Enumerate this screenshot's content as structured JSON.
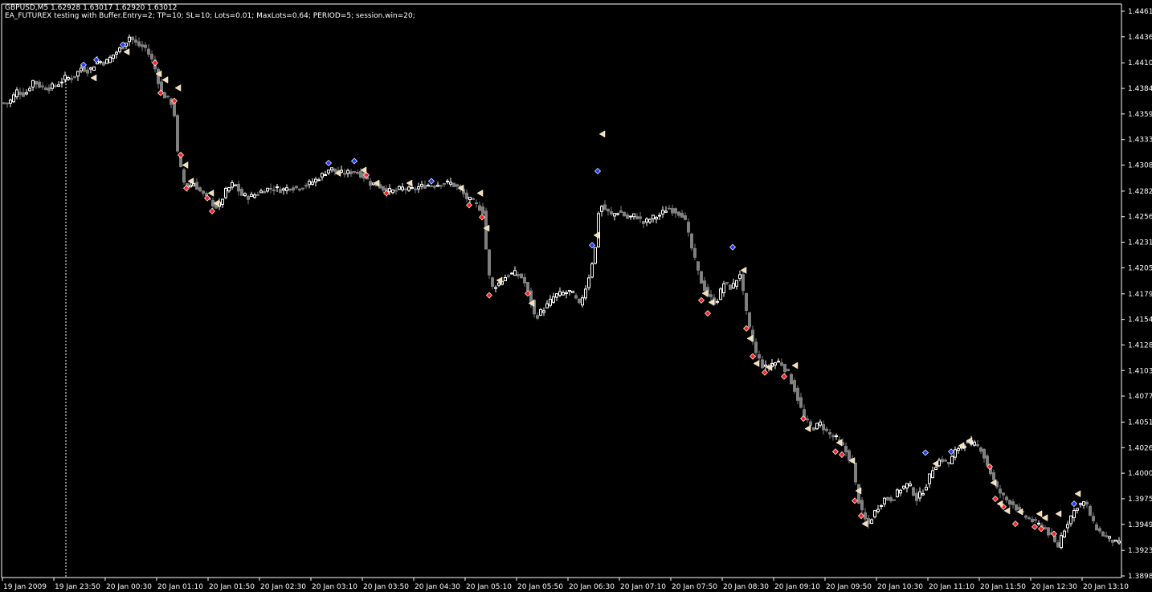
{
  "window": {
    "header": "GBPUSD,M5  1.62928 1.63017 1.62920 1.63012",
    "ea_info": "EA_FUTUREX testing with Buffer.Entry=2; TP=10; SL=10; Lots=0.01; MaxLots=0.64; PERIOD=5; session.win=20;"
  },
  "colors": {
    "background": "#000000",
    "bull_candle": "#ffffff",
    "bear_candle": "#7f7f7f",
    "axis": "#ffffff",
    "session_line": "#ffffff",
    "buy_arrow": "#1e3cff",
    "sell_arrow": "#ff2020",
    "close_marker": "#f5deb3"
  },
  "price_axis": {
    "ticks": [
      "1.44615",
      "1.44360",
      "1.44100",
      "1.43845",
      "1.43590",
      "1.43335",
      "1.43080",
      "1.42820",
      "1.42565",
      "1.42310",
      "1.42055",
      "1.41795",
      "1.41540",
      "1.41285",
      "1.41030",
      "1.40775",
      "1.40515",
      "1.40260",
      "1.40005",
      "1.39750",
      "1.39495",
      "1.39235",
      "1.38980"
    ]
  },
  "time_axis": {
    "ticks": [
      "19 Jan 2009",
      "19 Jan 23:50",
      "20 Jan 00:30",
      "20 Jan 01:10",
      "20 Jan 01:50",
      "20 Jan 02:30",
      "20 Jan 03:10",
      "20 Jan 03:50",
      "20 Jan 04:30",
      "20 Jan 05:10",
      "20 Jan 05:50",
      "20 Jan 06:30",
      "20 Jan 07:10",
      "20 Jan 07:50",
      "20 Jan 08:30",
      "20 Jan 09:10",
      "20 Jan 09:50",
      "20 Jan 10:30",
      "20 Jan 11:10",
      "20 Jan 11:50",
      "20 Jan 12:30",
      "20 Jan 13:10"
    ]
  },
  "chart_data": {
    "type": "candlestick",
    "symbol": "GBPUSD",
    "timeframe": "M5",
    "ylim": [
      1.3898,
      1.44615
    ],
    "price_path": [
      [
        0,
        1.437
      ],
      [
        10,
        1.437
      ],
      [
        20,
        1.4382
      ],
      [
        30,
        1.4378
      ],
      [
        40,
        1.4392
      ],
      [
        50,
        1.4386
      ],
      [
        60,
        1.4385
      ],
      [
        70,
        1.4388
      ],
      [
        80,
        1.4395
      ],
      [
        90,
        1.4395
      ],
      [
        100,
        1.4405
      ],
      [
        110,
        1.4402
      ],
      [
        120,
        1.4412
      ],
      [
        130,
        1.441
      ],
      [
        140,
        1.4418
      ],
      [
        150,
        1.4425
      ],
      [
        160,
        1.4436
      ],
      [
        170,
        1.4428
      ],
      [
        180,
        1.4425
      ],
      [
        190,
        1.441
      ],
      [
        200,
        1.438
      ],
      [
        210,
        1.4372
      ],
      [
        215,
        1.4368
      ],
      [
        220,
        1.432
      ],
      [
        225,
        1.43
      ],
      [
        230,
        1.4285
      ],
      [
        240,
        1.429
      ],
      [
        250,
        1.428
      ],
      [
        260,
        1.4272
      ],
      [
        270,
        1.4265
      ],
      [
        280,
        1.4282
      ],
      [
        290,
        1.429
      ],
      [
        300,
        1.4278
      ],
      [
        310,
        1.4276
      ],
      [
        320,
        1.428
      ],
      [
        330,
        1.4284
      ],
      [
        340,
        1.4285
      ],
      [
        350,
        1.4283
      ],
      [
        360,
        1.4286
      ],
      [
        370,
        1.4285
      ],
      [
        380,
        1.4288
      ],
      [
        390,
        1.4292
      ],
      [
        400,
        1.4298
      ],
      [
        410,
        1.4305
      ],
      [
        420,
        1.43
      ],
      [
        430,
        1.43
      ],
      [
        440,
        1.4302
      ],
      [
        450,
        1.4298
      ],
      [
        460,
        1.429
      ],
      [
        470,
        1.4288
      ],
      [
        480,
        1.4282
      ],
      [
        490,
        1.4282
      ],
      [
        500,
        1.4285
      ],
      [
        510,
        1.4283
      ],
      [
        520,
        1.4286
      ],
      [
        530,
        1.4288
      ],
      [
        540,
        1.4288
      ],
      [
        550,
        1.429
      ],
      [
        560,
        1.429
      ],
      [
        570,
        1.4285
      ],
      [
        580,
        1.4275
      ],
      [
        590,
        1.427
      ],
      [
        600,
        1.4262
      ],
      [
        605,
        1.4215
      ],
      [
        610,
        1.4185
      ],
      [
        620,
        1.419
      ],
      [
        630,
        1.4198
      ],
      [
        640,
        1.42
      ],
      [
        650,
        1.4195
      ],
      [
        660,
        1.4172
      ],
      [
        665,
        1.4155
      ],
      [
        670,
        1.416
      ],
      [
        680,
        1.4168
      ],
      [
        690,
        1.4178
      ],
      [
        700,
        1.418
      ],
      [
        710,
        1.4182
      ],
      [
        720,
        1.4168
      ],
      [
        730,
        1.419
      ],
      [
        740,
        1.4225
      ],
      [
        745,
        1.427
      ],
      [
        750,
        1.4265
      ],
      [
        760,
        1.4258
      ],
      [
        770,
        1.4262
      ],
      [
        780,
        1.4255
      ],
      [
        790,
        1.4258
      ],
      [
        800,
        1.425
      ],
      [
        810,
        1.4255
      ],
      [
        820,
        1.4258
      ],
      [
        830,
        1.4265
      ],
      [
        840,
        1.4262
      ],
      [
        850,
        1.4258
      ],
      [
        860,
        1.4225
      ],
      [
        870,
        1.4195
      ],
      [
        880,
        1.4178
      ],
      [
        890,
        1.417
      ],
      [
        900,
        1.419
      ],
      [
        910,
        1.4185
      ],
      [
        920,
        1.42
      ],
      [
        925,
        1.4175
      ],
      [
        930,
        1.415
      ],
      [
        940,
        1.412
      ],
      [
        950,
        1.4105
      ],
      [
        960,
        1.411
      ],
      [
        970,
        1.4112
      ],
      [
        980,
        1.41
      ],
      [
        990,
        1.408
      ],
      [
        1000,
        1.4055
      ],
      [
        1010,
        1.4045
      ],
      [
        1020,
        1.405
      ],
      [
        1030,
        1.404
      ],
      [
        1040,
        1.4035
      ],
      [
        1050,
        1.4025
      ],
      [
        1060,
        1.401
      ],
      [
        1065,
        1.3985
      ],
      [
        1070,
        1.3965
      ],
      [
        1075,
        1.3955
      ],
      [
        1080,
        1.395
      ],
      [
        1090,
        1.3965
      ],
      [
        1100,
        1.3975
      ],
      [
        1110,
        1.3975
      ],
      [
        1120,
        1.3985
      ],
      [
        1130,
        1.399
      ],
      [
        1140,
        1.3975
      ],
      [
        1150,
        1.3985
      ],
      [
        1160,
        1.4005
      ],
      [
        1170,
        1.4015
      ],
      [
        1180,
        1.401
      ],
      [
        1190,
        1.4025
      ],
      [
        1200,
        1.403
      ],
      [
        1210,
        1.403
      ],
      [
        1220,
        1.4025
      ],
      [
        1230,
        1.4005
      ],
      [
        1240,
        1.3985
      ],
      [
        1250,
        1.3975
      ],
      [
        1260,
        1.397
      ],
      [
        1270,
        1.396
      ],
      [
        1280,
        1.3955
      ],
      [
        1290,
        1.395
      ],
      [
        1300,
        1.3945
      ],
      [
        1310,
        1.3935
      ],
      [
        1315,
        1.3925
      ],
      [
        1320,
        1.3938
      ],
      [
        1330,
        1.3955
      ],
      [
        1340,
        1.3968
      ],
      [
        1350,
        1.3972
      ],
      [
        1360,
        1.395
      ],
      [
        1370,
        1.394
      ],
      [
        1380,
        1.3935
      ],
      [
        1390,
        1.393
      ]
    ],
    "sell_signals": [
      [
        193,
        1.441
      ],
      [
        200,
        1.438
      ],
      [
        217,
        1.4372
      ],
      [
        225,
        1.4318
      ],
      [
        232,
        1.4285
      ],
      [
        258,
        1.4275
      ],
      [
        264,
        1.4262
      ],
      [
        456,
        1.4298
      ],
      [
        481,
        1.428
      ],
      [
        584,
        1.4268
      ],
      [
        600,
        1.4256
      ],
      [
        609,
        1.4178
      ],
      [
        657,
        1.418
      ],
      [
        873,
        1.4173
      ],
      [
        881,
        1.416
      ],
      [
        929,
        1.4145
      ],
      [
        937,
        1.4117
      ],
      [
        952,
        1.4101
      ],
      [
        976,
        1.4097
      ],
      [
        1000,
        1.4055
      ],
      [
        1040,
        1.4022
      ],
      [
        1048,
        1.4019
      ],
      [
        1064,
        1.3973
      ],
      [
        1072,
        1.3958
      ],
      [
        1232,
        1.4007
      ],
      [
        1239,
        1.3975
      ],
      [
        1249,
        1.3967
      ],
      [
        1264,
        1.395
      ],
      [
        1288,
        1.3947
      ],
      [
        1296,
        1.3945
      ],
      [
        1312,
        1.394
      ]
    ],
    "buy_signals": [
      [
        104,
        1.4408
      ],
      [
        120,
        1.4413
      ],
      [
        153,
        1.4428
      ],
      [
        409,
        1.431
      ],
      [
        441,
        1.4312
      ],
      [
        537,
        1.4292
      ],
      [
        744,
        1.4302
      ],
      [
        737,
        1.4228
      ],
      [
        912,
        1.4226
      ],
      [
        1152,
        1.4021
      ],
      [
        1184,
        1.4022
      ],
      [
        1337,
        1.397
      ]
    ],
    "close_markers": [
      [
        116,
        1.4395
      ],
      [
        157,
        1.4421
      ],
      [
        197,
        1.4399
      ],
      [
        205,
        1.4393
      ],
      [
        221,
        1.4385
      ],
      [
        230,
        1.4308
      ],
      [
        237,
        1.4292
      ],
      [
        262,
        1.428
      ],
      [
        269,
        1.427
      ],
      [
        420,
        1.43
      ],
      [
        452,
        1.4303
      ],
      [
        468,
        1.429
      ],
      [
        509,
        1.429
      ],
      [
        573,
        1.4285
      ],
      [
        597,
        1.428
      ],
      [
        605,
        1.4245
      ],
      [
        621,
        1.4193
      ],
      [
        661,
        1.417
      ],
      [
        742,
        1.4238
      ],
      [
        749,
        1.4339
      ],
      [
        877,
        1.418
      ],
      [
        885,
        1.4171
      ],
      [
        925,
        1.4203
      ],
      [
        933,
        1.4135
      ],
      [
        941,
        1.411
      ],
      [
        957,
        1.4106
      ],
      [
        989,
        1.4108
      ],
      [
        1005,
        1.4045
      ],
      [
        1044,
        1.4031
      ],
      [
        1060,
        1.4013
      ],
      [
        1068,
        1.3983
      ],
      [
        1076,
        1.395
      ],
      [
        1164,
        1.401
      ],
      [
        1196,
        1.4028
      ],
      [
        1206,
        1.4033
      ],
      [
        1236,
        1.3991
      ],
      [
        1244,
        1.397
      ],
      [
        1253,
        1.3963
      ],
      [
        1269,
        1.3962
      ],
      [
        1293,
        1.396
      ],
      [
        1300,
        1.3956
      ],
      [
        1317,
        1.396
      ],
      [
        1341,
        1.398
      ]
    ]
  }
}
